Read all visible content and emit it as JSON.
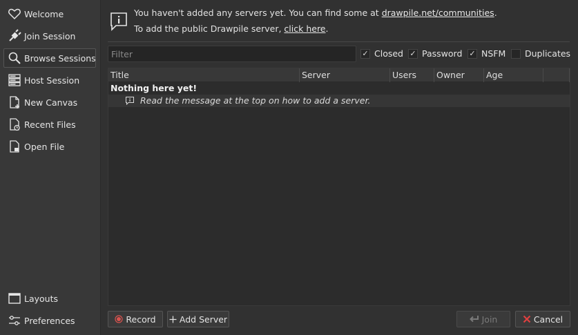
{
  "sidebar": {
    "items": [
      {
        "label": "Welcome",
        "icon": "heart-icon"
      },
      {
        "label": "Join Session",
        "icon": "plug-icon"
      },
      {
        "label": "Browse Sessions",
        "icon": "search-icon",
        "active": true
      },
      {
        "label": "Host Session",
        "icon": "server-icon"
      },
      {
        "label": "New Canvas",
        "icon": "new-document-icon"
      },
      {
        "label": "Recent Files",
        "icon": "recent-file-icon"
      },
      {
        "label": "Open File",
        "icon": "open-file-icon"
      }
    ],
    "bottom_items": [
      {
        "label": "Layouts",
        "icon": "window-icon"
      },
      {
        "label": "Preferences",
        "icon": "sliders-icon"
      }
    ]
  },
  "notice": {
    "line1_prefix": "You haven't added any servers yet. You can find some at ",
    "line1_link": "drawpile.net/communities",
    "line1_suffix": ".",
    "line2_prefix": "To add the public Drawpile server, ",
    "line2_link": "click here",
    "line2_suffix": "."
  },
  "filter": {
    "placeholder": "Filter",
    "value": ""
  },
  "checkboxes": [
    {
      "label": "Closed",
      "checked": true
    },
    {
      "label": "Password",
      "checked": true
    },
    {
      "label": "NSFM",
      "checked": true
    },
    {
      "label": "Duplicates",
      "checked": false
    }
  ],
  "table": {
    "columns": [
      "Title",
      "Server",
      "Users",
      "Owner",
      "Age"
    ],
    "group_label": "Nothing here yet!",
    "message": "Read the message at the top on how to add a server."
  },
  "buttons": {
    "record": "Record",
    "add_server": "Add Server",
    "join": "Join",
    "cancel": "Cancel"
  },
  "colors": {
    "background": "#313131",
    "sidebar": "#383838",
    "record_red": "#d9534f",
    "cancel_red": "#e04040"
  }
}
